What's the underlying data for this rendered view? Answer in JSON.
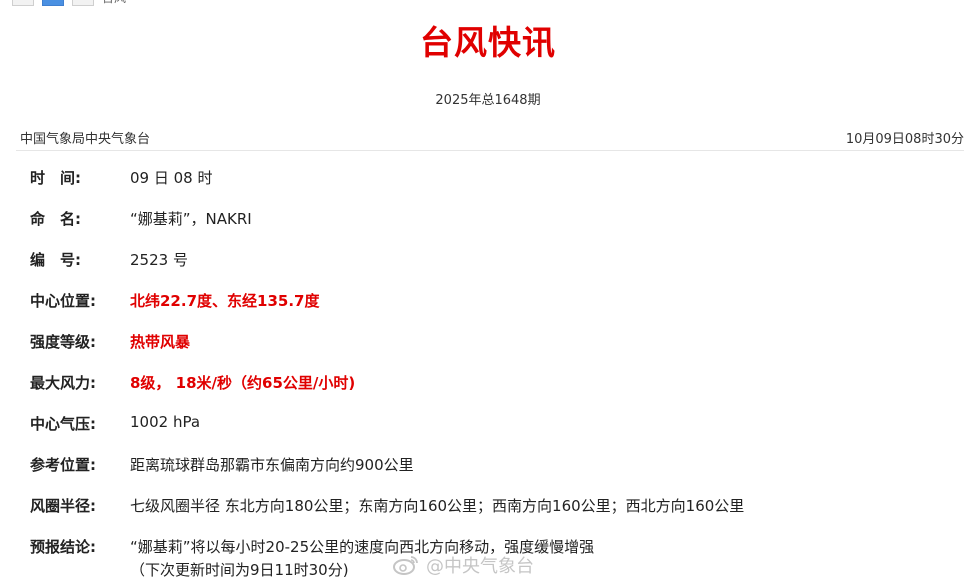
{
  "header": {
    "title": "台风快讯",
    "issue": "2025年总1648期",
    "agency": "中国气象局中央气象台",
    "timestamp": "10月09日08时30分",
    "topbar_hint": "台风"
  },
  "rows": [
    {
      "label": "时　间:",
      "value": "09 日 08 时"
    },
    {
      "label": "命　名:",
      "value": "“娜基莉”，NAKRI"
    },
    {
      "label": "编　号:",
      "value": "2523 号"
    },
    {
      "label": "中心位置:",
      "value": "北纬22.7度、东经135.7度"
    },
    {
      "label": "强度等级:",
      "value": "热带风暴"
    },
    {
      "label": "最大风力:",
      "value": "8级， 18米/秒（约65公里/小时)"
    },
    {
      "label": "中心气压:",
      "value": "1002 hPa"
    },
    {
      "label": "参考位置:",
      "value": "距离琉球群岛那霸市东偏南方向约900公里"
    },
    {
      "label": "风圈半径:",
      "value": "七级风圈半径 东北方向180公里；东南方向160公里；西南方向160公里；西北方向160公里"
    },
    {
      "label": "预报结论:",
      "value": "“娜基莉”将以每小时20-25公里的速度向西北方向移动，强度缓慢增强",
      "value_line2": "（下次更新时间为9日11时30分)"
    }
  ],
  "colors": {
    "accent_red": "#e00000",
    "text": "#222222"
  },
  "watermark": {
    "text": "@中央气象台",
    "icon": "weibo-icon"
  }
}
